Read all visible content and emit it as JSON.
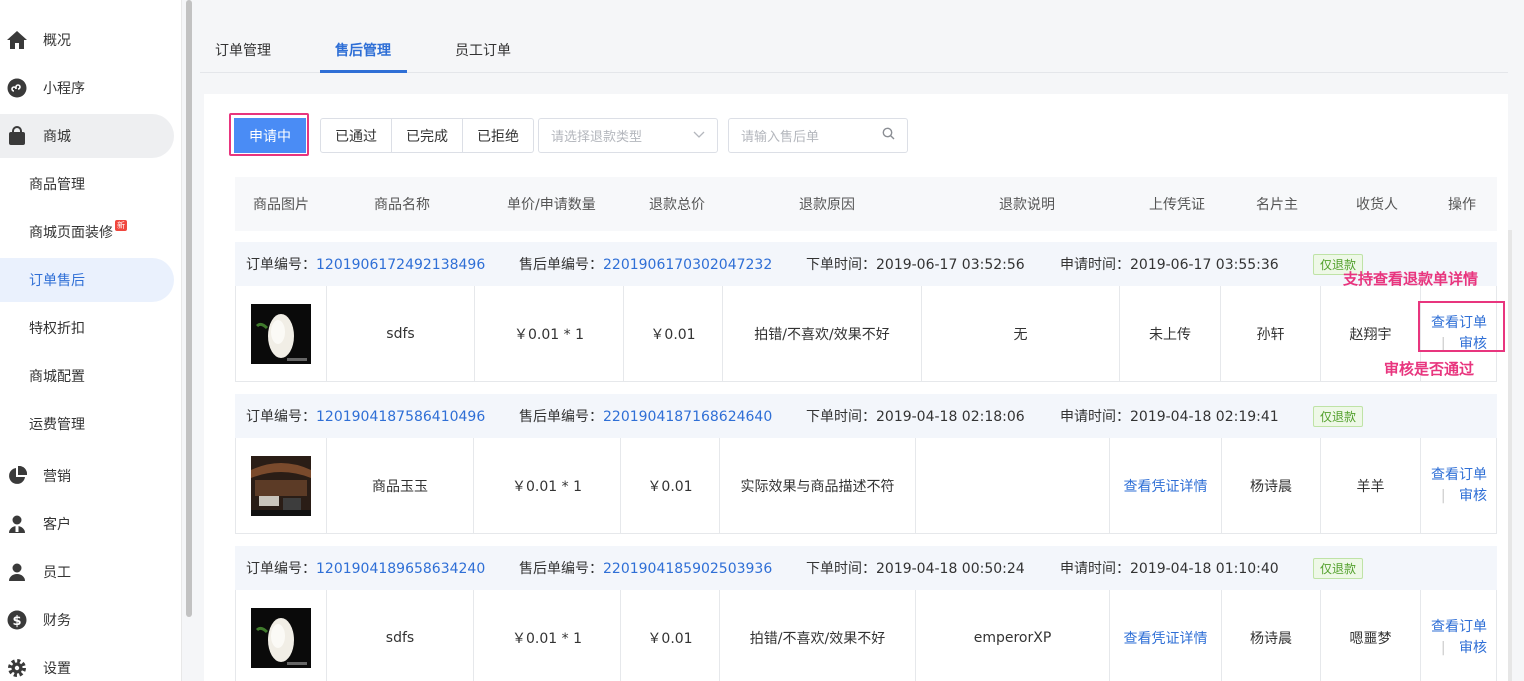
{
  "sidebar": {
    "items": [
      {
        "label": "概况",
        "icon": "home-icon"
      },
      {
        "label": "小程序",
        "icon": "miniprogram-icon"
      },
      {
        "label": "商城",
        "icon": "shopping-bag-icon"
      },
      {
        "label": "商品管理"
      },
      {
        "label": "商城页面装修",
        "badge": "新"
      },
      {
        "label": "订单售后"
      },
      {
        "label": "特权折扣"
      },
      {
        "label": "商城配置"
      },
      {
        "label": "运费管理"
      },
      {
        "label": "营销",
        "icon": "pie-chart-icon"
      },
      {
        "label": "客户",
        "icon": "customer-icon"
      },
      {
        "label": "员工",
        "icon": "staff-icon"
      },
      {
        "label": "财务",
        "icon": "dollar-icon"
      },
      {
        "label": "设置",
        "icon": "gear-icon"
      }
    ]
  },
  "tabs": [
    "订单管理",
    "售后管理",
    "员工订单"
  ],
  "filters": [
    "申请中",
    "已通过",
    "已完成",
    "已拒绝"
  ],
  "refund_type_select": {
    "placeholder": "请选择退款类型"
  },
  "search": {
    "placeholder": "请输入售后单"
  },
  "columns": [
    "商品图片",
    "商品名称",
    "单价/申请数量",
    "退款总价",
    "退款原因",
    "退款说明",
    "上传凭证",
    "名片主",
    "收货人",
    "操作"
  ],
  "labels": {
    "order_no": "订单编号：",
    "after_sale_no": "售后单编号：",
    "order_time": "下单时间：",
    "apply_time": "申请时间："
  },
  "orders": [
    {
      "order_no": "1201906172492138496",
      "after_sale_no": "2201906170302047232",
      "order_time": "2019-06-17 03:52:56",
      "apply_time": "2019-06-17 03:55:36",
      "tag": "仅退款",
      "name": "sdfs",
      "price_qty": "￥0.01 * 1",
      "total": "￥0.01",
      "reason": "拍错/不喜欢/效果不好",
      "desc": "无",
      "voucher": "未上传",
      "card_owner": "孙轩",
      "receiver": "赵翔宇",
      "op_view": "查看订单",
      "op_audit": "审核"
    },
    {
      "order_no": "1201904187586410496",
      "after_sale_no": "2201904187168624640",
      "order_time": "2019-04-18 02:18:06",
      "apply_time": "2019-04-18 02:19:41",
      "tag": "仅退款",
      "name": "商品玉玉",
      "price_qty": "￥0.01 * 1",
      "total": "￥0.01",
      "reason": "实际效果与商品描述不符",
      "desc": "",
      "voucher": "查看凭证详情",
      "card_owner": "杨诗晨",
      "receiver": "羊羊",
      "op_view": "查看订单",
      "op_audit": "审核"
    },
    {
      "order_no": "1201904189658634240",
      "after_sale_no": "2201904185902503936",
      "order_time": "2019-04-18 00:50:24",
      "apply_time": "2019-04-18 01:10:40",
      "tag": "仅退款",
      "name": "sdfs",
      "price_qty": "￥0.01 * 1",
      "total": "￥0.01",
      "reason": "拍错/不喜欢/效果不好",
      "desc": "emperorXP",
      "voucher": "查看凭证详情",
      "card_owner": "杨诗晨",
      "receiver": "嗯噩梦",
      "op_view": "查看订单",
      "op_audit": "审核"
    }
  ],
  "annotations": {
    "detail": "支持查看退款单详情",
    "audit": "审核是否通过"
  },
  "colors": {
    "accent": "#2f6fd6",
    "primary_button": "#4a8cf5",
    "highlight": "#e8357e",
    "tag_green": "#52a02b"
  }
}
